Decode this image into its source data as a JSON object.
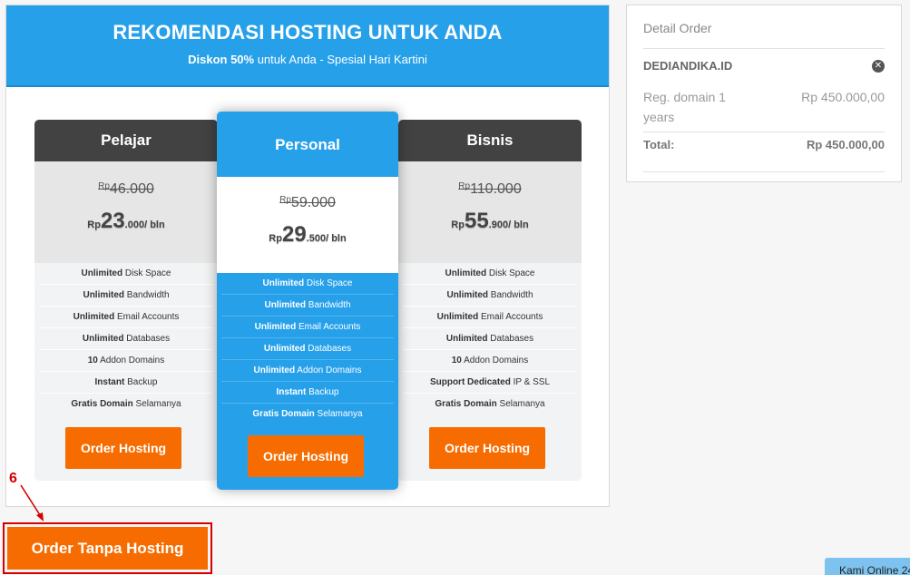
{
  "recommendation": {
    "title": "REKOMENDASI HOSTING UNTUK ANDA",
    "subtitle_bold": "Diskon 50%",
    "subtitle_rest": " untuk Anda - Spesial Hari Kartini"
  },
  "plans": [
    {
      "name": "Pelajar",
      "old_currency": "Rp",
      "old_price": "46.000",
      "new_currency": "Rp",
      "new_price_big": "23",
      "new_price_tail": ".000/ bln",
      "features": [
        {
          "bold": "Unlimited",
          "text": " Disk Space"
        },
        {
          "bold": "Unlimited",
          "text": " Bandwidth"
        },
        {
          "bold": "Unlimited",
          "text": " Email Accounts"
        },
        {
          "bold": "Unlimited",
          "text": " Databases"
        },
        {
          "bold": "10",
          "text": " Addon Domains"
        },
        {
          "bold": "Instant",
          "text": " Backup"
        },
        {
          "bold": "Gratis Domain",
          "text": " Selamanya"
        }
      ],
      "button": "Order Hosting"
    },
    {
      "name": "Personal",
      "old_currency": "Rp",
      "old_price": "59.000",
      "new_currency": "Rp",
      "new_price_big": "29",
      "new_price_tail": ".500/ bln",
      "features": [
        {
          "bold": "Unlimited",
          "text": " Disk Space"
        },
        {
          "bold": "Unlimited",
          "text": " Bandwidth"
        },
        {
          "bold": "Unlimited",
          "text": " Email Accounts"
        },
        {
          "bold": "Unlimited",
          "text": " Databases"
        },
        {
          "bold": "Unlimited",
          "text": " Addon Domains"
        },
        {
          "bold": "Instant",
          "text": " Backup"
        },
        {
          "bold": "Gratis Domain",
          "text": " Selamanya"
        }
      ],
      "button": "Order Hosting"
    },
    {
      "name": "Bisnis",
      "old_currency": "Rp",
      "old_price": "110.000",
      "new_currency": "Rp",
      "new_price_big": "55",
      "new_price_tail": ".900/ bln",
      "features": [
        {
          "bold": "Unlimited",
          "text": " Disk Space"
        },
        {
          "bold": "Unlimited",
          "text": " Bandwidth"
        },
        {
          "bold": "Unlimited",
          "text": " Email Accounts"
        },
        {
          "bold": "Unlimited",
          "text": " Databases"
        },
        {
          "bold": "10",
          "text": " Addon Domains"
        },
        {
          "bold": "Support Dedicated",
          "text": " IP & SSL"
        },
        {
          "bold": "Gratis Domain",
          "text": " Selamanya"
        }
      ],
      "button": "Order Hosting"
    }
  ],
  "order": {
    "heading": "Detail Order",
    "domain": "DEDIANDIKA.ID",
    "item": "Reg. domain 1 years",
    "item_price": "Rp 450.000,00",
    "total_label": "Total:",
    "total_value": "Rp 450.000,00"
  },
  "annotation": {
    "number": "6"
  },
  "no_hosting_button": "Order Tanpa Hosting",
  "chat_tab": "Kami Online 24",
  "colors": {
    "brand_blue": "#27a0ea",
    "order_orange": "#f76c00",
    "annotation_red": "#d40000",
    "plan_header_dark": "#424242"
  }
}
